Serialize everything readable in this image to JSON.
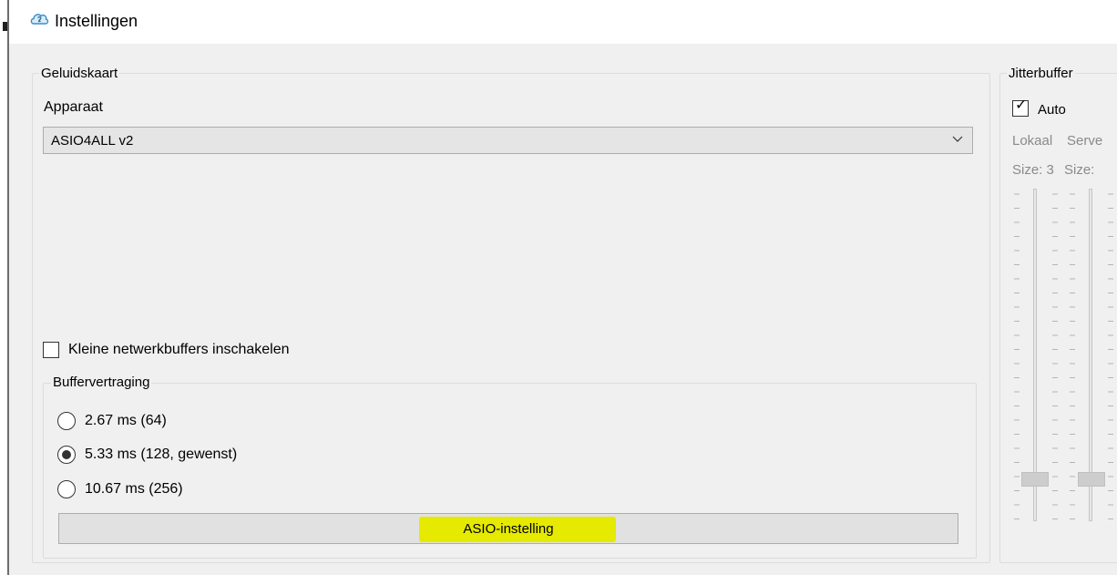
{
  "window": {
    "title": "Instellingen"
  },
  "sound_card": {
    "group_label": "Geluidskaart",
    "device_label": "Apparaat",
    "device_value": "ASIO4ALL v2",
    "small_buffers_label": "Kleine netwerkbuffers inschakelen",
    "small_buffers_checked": false
  },
  "buffer_delay": {
    "group_label": "Buffervertraging",
    "options": [
      {
        "label": "2.67 ms (64)",
        "selected": false
      },
      {
        "label": "5.33 ms (128, gewenst)",
        "selected": true
      },
      {
        "label": "10.67 ms (256)",
        "selected": false
      }
    ],
    "asio_button_label": "ASIO-instelling",
    "highlight_color": "#e5ea00"
  },
  "jitter_buffer": {
    "group_label": "Jitterbuffer",
    "auto_label": "Auto",
    "auto_checked": true,
    "local_label": "Lokaal",
    "server_label": "Serve",
    "local_size_label": "Size: 3",
    "server_size_label": "Size:"
  },
  "icons": {
    "app": "jamulus-cloud-icon",
    "dropdown": "chevron-down-icon"
  }
}
